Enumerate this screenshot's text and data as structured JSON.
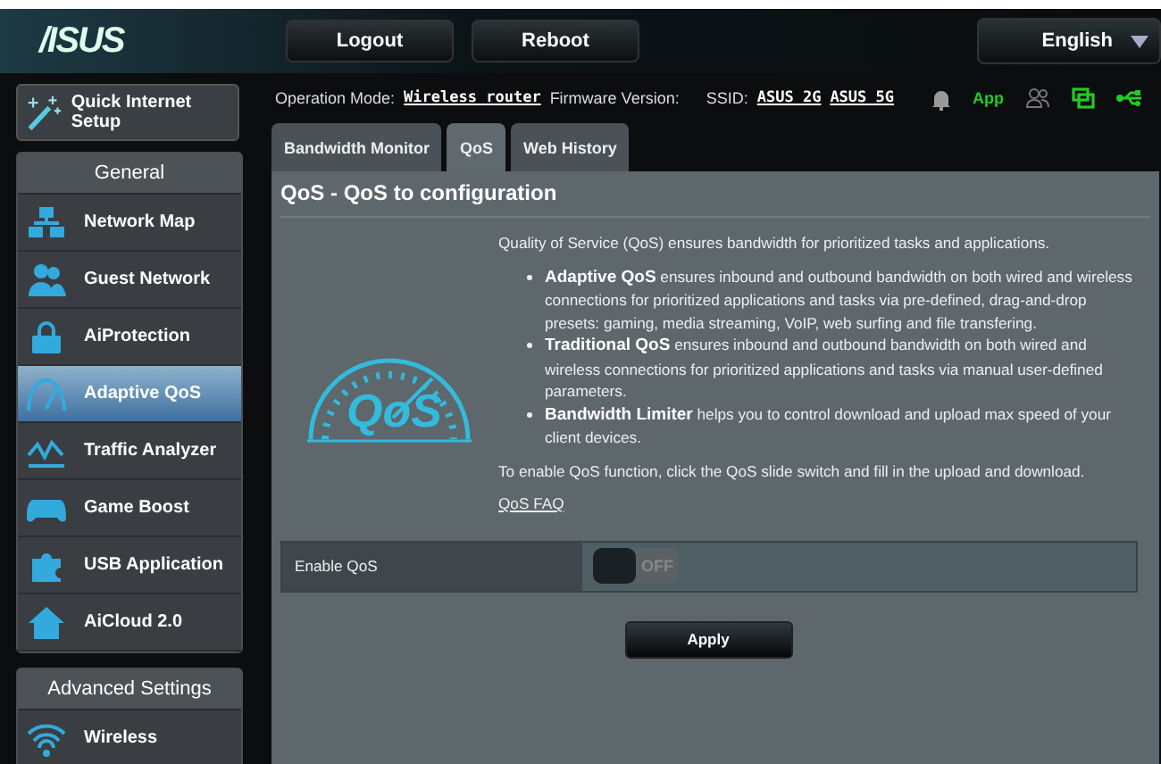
{
  "header": {
    "logo": "/ISUS",
    "buttons": [
      "Logout",
      "Reboot"
    ],
    "language": "English"
  },
  "quick_setup": {
    "label": "Quick Internet Setup"
  },
  "sidebar": {
    "general_title": "General",
    "items": [
      {
        "label": "Network Map",
        "selected": false
      },
      {
        "label": "Guest Network",
        "selected": false
      },
      {
        "label": "AiProtection",
        "selected": false
      },
      {
        "label": "Adaptive QoS",
        "selected": true
      },
      {
        "label": "Traffic Analyzer",
        "selected": false
      },
      {
        "label": "Game Boost",
        "selected": false
      },
      {
        "label": "USB Application",
        "selected": false
      },
      {
        "label": "AiCloud 2.0",
        "selected": false
      }
    ],
    "advanced_title": "Advanced Settings",
    "advanced_items": [
      {
        "label": "Wireless",
        "selected": false
      }
    ]
  },
  "status": {
    "mode_label": "Operation Mode:",
    "mode": "Wireless_router",
    "firmware_label": "Firmware Version:",
    "ssid_label": "SSID:",
    "ssids": [
      "ASUS_2G",
      "ASUS_5G"
    ],
    "app": "App"
  },
  "tabs": [
    {
      "label": "Bandwidth Monitor",
      "selected": false
    },
    {
      "label": "QoS",
      "selected": true
    },
    {
      "label": "Web History",
      "selected": false
    }
  ],
  "panel": {
    "title": "QoS - QoS to configuration",
    "intro": "Quality of Service (QoS) ensures bandwidth for prioritized tasks and applications.",
    "bullets": [
      "**Adaptive QoS** ensures inbound and outbound bandwidth on both wired and wireless connections for prioritized applications and tasks via pre-defined, drag-and-drop presets: gaming, media streaming, VoIP, web surfing and file transfering.",
      "**Traditional QoS** ensures inbound and outbound bandwidth on both wired and wireless connections for prioritized applications and tasks via manual user-defined parameters.",
      "**Bandwidth Limiter** helps you to control download and upload max speed of your client devices."
    ],
    "note": "To enable QoS function, click the QoS slide switch and fill in the upload and download.",
    "faq": "QoS FAQ",
    "logo_text": "QoS",
    "setting": {
      "label": "Enable QoS",
      "on": false,
      "state_text": "OFF"
    },
    "apply": "Apply"
  }
}
